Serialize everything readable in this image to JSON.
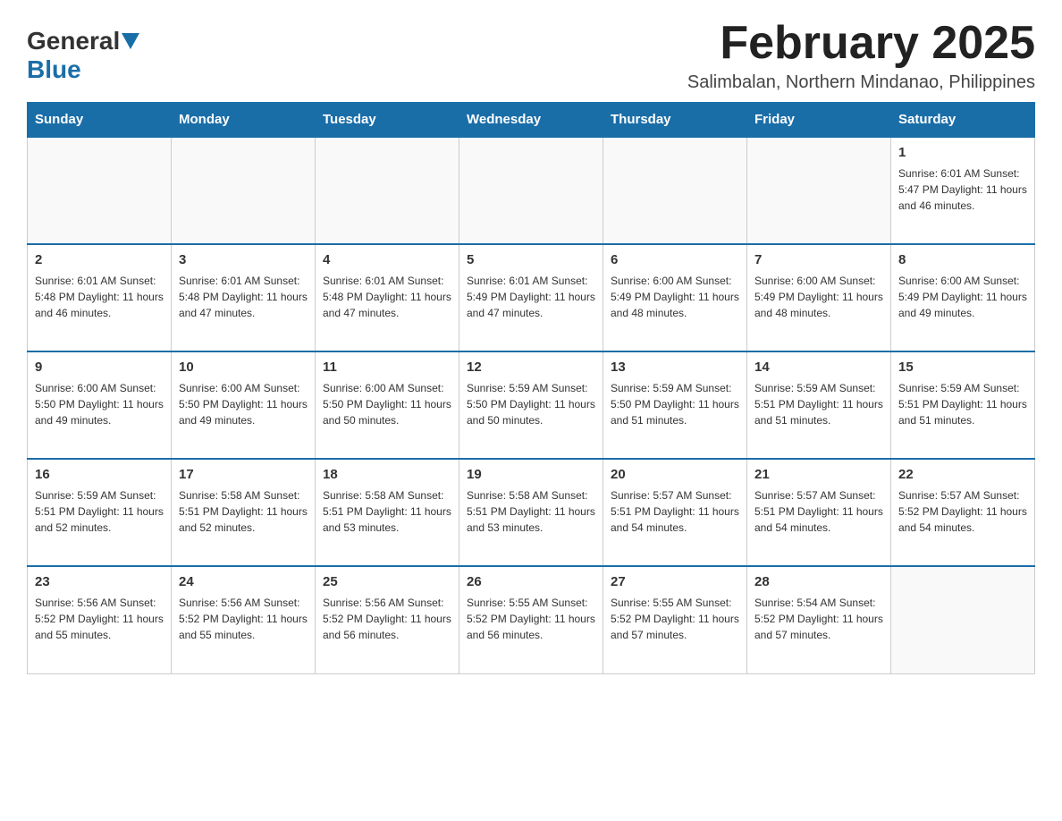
{
  "logo": {
    "general": "General",
    "blue": "Blue"
  },
  "header": {
    "month_title": "February 2025",
    "location": "Salimbalan, Northern Mindanao, Philippines"
  },
  "days_of_week": [
    "Sunday",
    "Monday",
    "Tuesday",
    "Wednesday",
    "Thursday",
    "Friday",
    "Saturday"
  ],
  "weeks": [
    [
      {
        "day": "",
        "info": ""
      },
      {
        "day": "",
        "info": ""
      },
      {
        "day": "",
        "info": ""
      },
      {
        "day": "",
        "info": ""
      },
      {
        "day": "",
        "info": ""
      },
      {
        "day": "",
        "info": ""
      },
      {
        "day": "1",
        "info": "Sunrise: 6:01 AM\nSunset: 5:47 PM\nDaylight: 11 hours\nand 46 minutes."
      }
    ],
    [
      {
        "day": "2",
        "info": "Sunrise: 6:01 AM\nSunset: 5:48 PM\nDaylight: 11 hours\nand 46 minutes."
      },
      {
        "day": "3",
        "info": "Sunrise: 6:01 AM\nSunset: 5:48 PM\nDaylight: 11 hours\nand 47 minutes."
      },
      {
        "day": "4",
        "info": "Sunrise: 6:01 AM\nSunset: 5:48 PM\nDaylight: 11 hours\nand 47 minutes."
      },
      {
        "day": "5",
        "info": "Sunrise: 6:01 AM\nSunset: 5:49 PM\nDaylight: 11 hours\nand 47 minutes."
      },
      {
        "day": "6",
        "info": "Sunrise: 6:00 AM\nSunset: 5:49 PM\nDaylight: 11 hours\nand 48 minutes."
      },
      {
        "day": "7",
        "info": "Sunrise: 6:00 AM\nSunset: 5:49 PM\nDaylight: 11 hours\nand 48 minutes."
      },
      {
        "day": "8",
        "info": "Sunrise: 6:00 AM\nSunset: 5:49 PM\nDaylight: 11 hours\nand 49 minutes."
      }
    ],
    [
      {
        "day": "9",
        "info": "Sunrise: 6:00 AM\nSunset: 5:50 PM\nDaylight: 11 hours\nand 49 minutes."
      },
      {
        "day": "10",
        "info": "Sunrise: 6:00 AM\nSunset: 5:50 PM\nDaylight: 11 hours\nand 49 minutes."
      },
      {
        "day": "11",
        "info": "Sunrise: 6:00 AM\nSunset: 5:50 PM\nDaylight: 11 hours\nand 50 minutes."
      },
      {
        "day": "12",
        "info": "Sunrise: 5:59 AM\nSunset: 5:50 PM\nDaylight: 11 hours\nand 50 minutes."
      },
      {
        "day": "13",
        "info": "Sunrise: 5:59 AM\nSunset: 5:50 PM\nDaylight: 11 hours\nand 51 minutes."
      },
      {
        "day": "14",
        "info": "Sunrise: 5:59 AM\nSunset: 5:51 PM\nDaylight: 11 hours\nand 51 minutes."
      },
      {
        "day": "15",
        "info": "Sunrise: 5:59 AM\nSunset: 5:51 PM\nDaylight: 11 hours\nand 51 minutes."
      }
    ],
    [
      {
        "day": "16",
        "info": "Sunrise: 5:59 AM\nSunset: 5:51 PM\nDaylight: 11 hours\nand 52 minutes."
      },
      {
        "day": "17",
        "info": "Sunrise: 5:58 AM\nSunset: 5:51 PM\nDaylight: 11 hours\nand 52 minutes."
      },
      {
        "day": "18",
        "info": "Sunrise: 5:58 AM\nSunset: 5:51 PM\nDaylight: 11 hours\nand 53 minutes."
      },
      {
        "day": "19",
        "info": "Sunrise: 5:58 AM\nSunset: 5:51 PM\nDaylight: 11 hours\nand 53 minutes."
      },
      {
        "day": "20",
        "info": "Sunrise: 5:57 AM\nSunset: 5:51 PM\nDaylight: 11 hours\nand 54 minutes."
      },
      {
        "day": "21",
        "info": "Sunrise: 5:57 AM\nSunset: 5:51 PM\nDaylight: 11 hours\nand 54 minutes."
      },
      {
        "day": "22",
        "info": "Sunrise: 5:57 AM\nSunset: 5:52 PM\nDaylight: 11 hours\nand 54 minutes."
      }
    ],
    [
      {
        "day": "23",
        "info": "Sunrise: 5:56 AM\nSunset: 5:52 PM\nDaylight: 11 hours\nand 55 minutes."
      },
      {
        "day": "24",
        "info": "Sunrise: 5:56 AM\nSunset: 5:52 PM\nDaylight: 11 hours\nand 55 minutes."
      },
      {
        "day": "25",
        "info": "Sunrise: 5:56 AM\nSunset: 5:52 PM\nDaylight: 11 hours\nand 56 minutes."
      },
      {
        "day": "26",
        "info": "Sunrise: 5:55 AM\nSunset: 5:52 PM\nDaylight: 11 hours\nand 56 minutes."
      },
      {
        "day": "27",
        "info": "Sunrise: 5:55 AM\nSunset: 5:52 PM\nDaylight: 11 hours\nand 57 minutes."
      },
      {
        "day": "28",
        "info": "Sunrise: 5:54 AM\nSunset: 5:52 PM\nDaylight: 11 hours\nand 57 minutes."
      },
      {
        "day": "",
        "info": ""
      }
    ]
  ]
}
